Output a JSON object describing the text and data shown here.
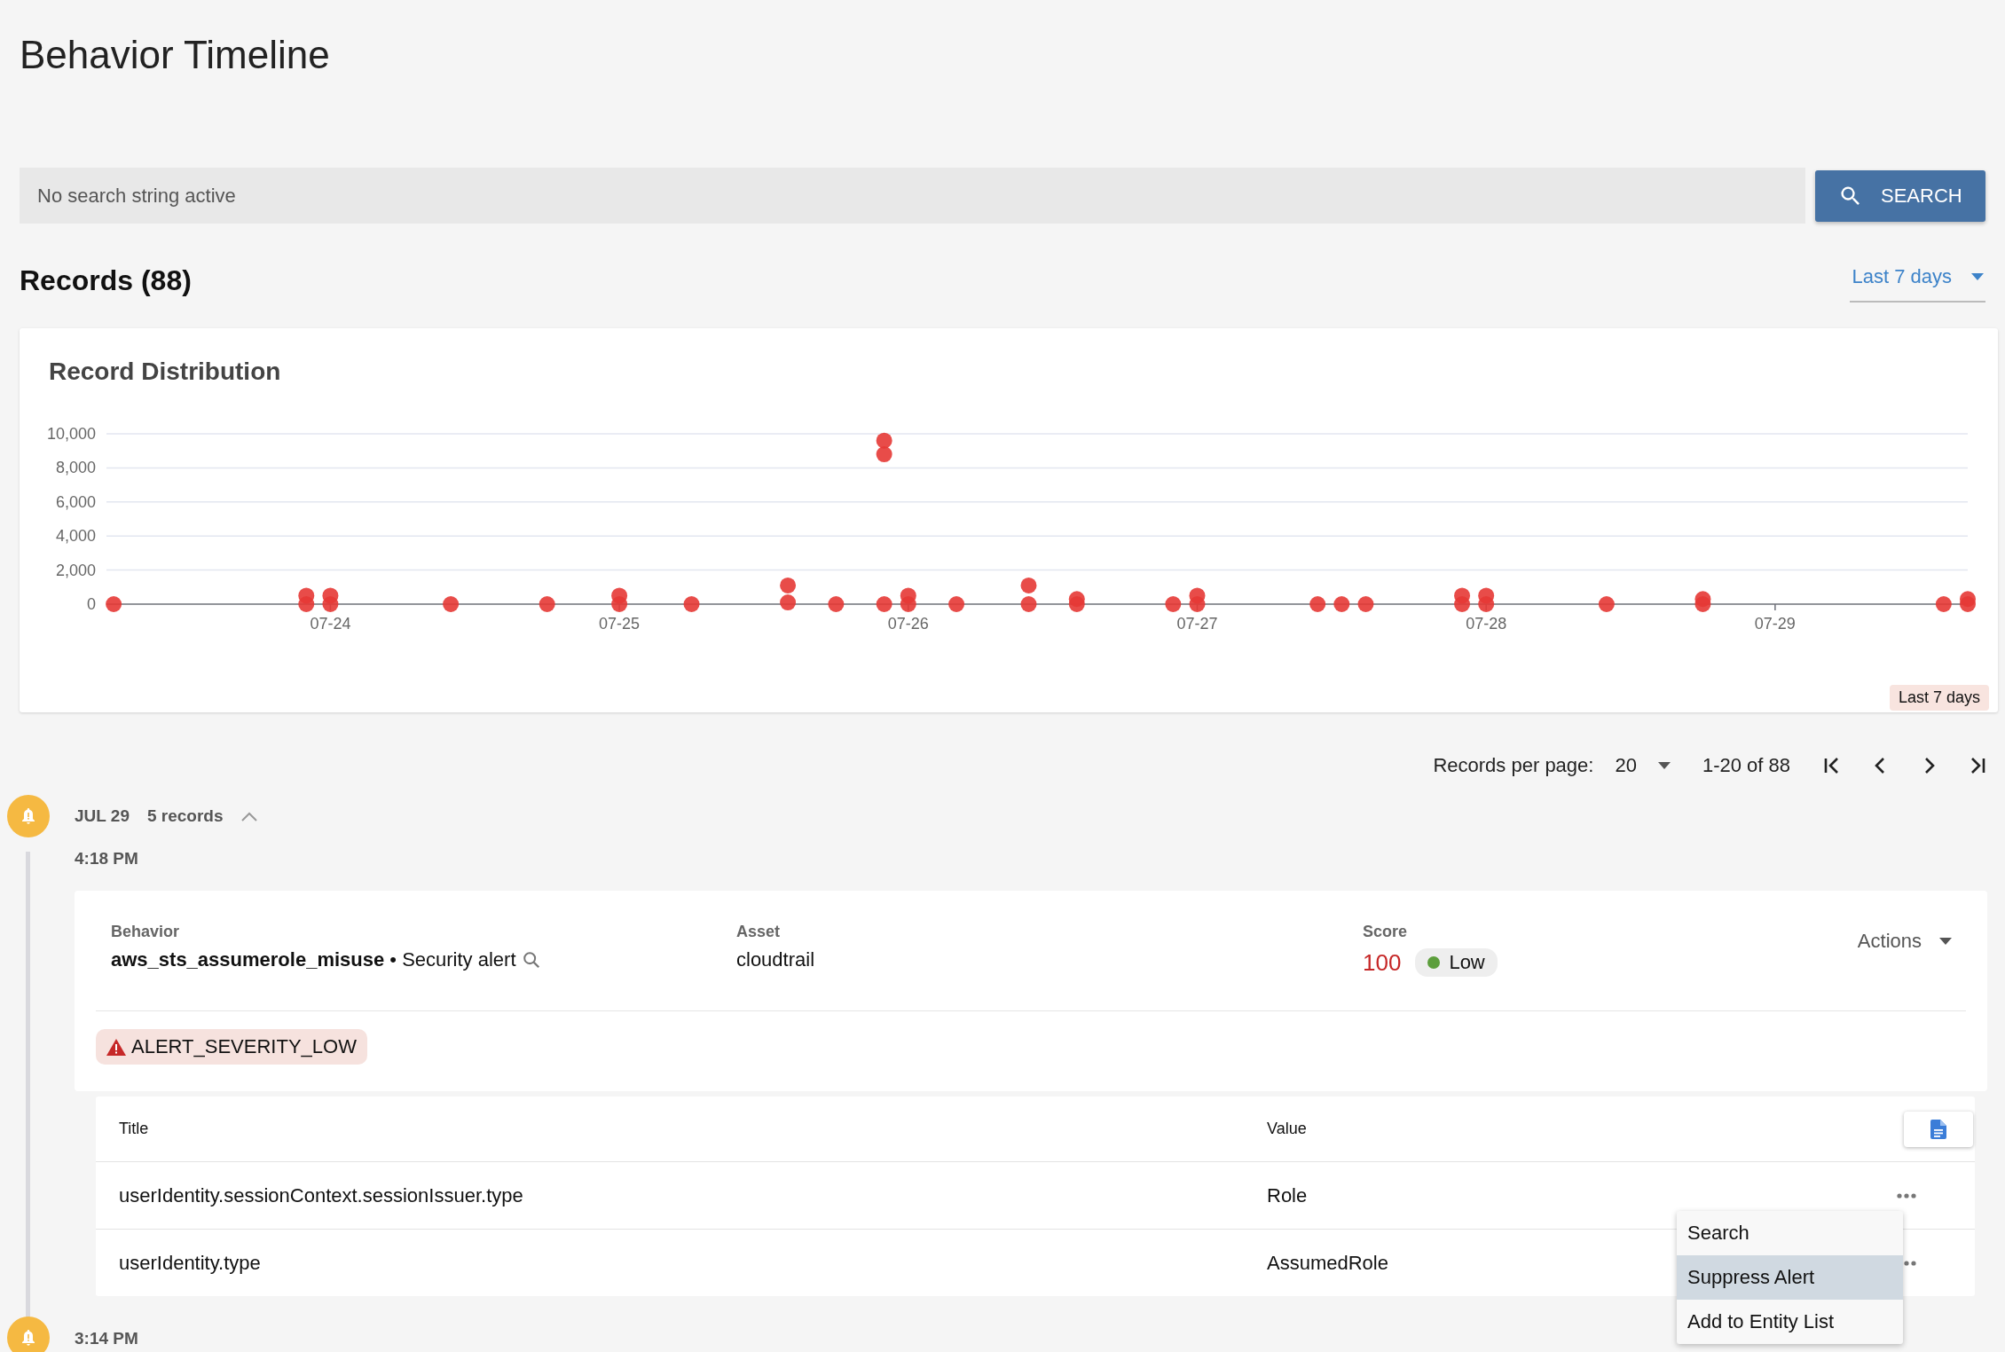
{
  "page_title": "Behavior Timeline",
  "search": {
    "placeholder": "No search string active",
    "button": "SEARCH"
  },
  "records_heading": "Records (88)",
  "range_dropdown": {
    "value": "Last 7 days"
  },
  "distribution": {
    "title": "Record Distribution",
    "range_badge": "Last 7 days",
    "chart_data": {
      "type": "scatter",
      "categories": [
        null,
        null,
        null,
        null,
        null,
        null,
        null,
        null,
        null,
        "07-24",
        null,
        null,
        null,
        null,
        null,
        null,
        null,
        null,
        null,
        null,
        null,
        "07-25",
        null,
        null,
        null,
        null,
        null,
        null,
        null,
        null,
        null,
        null,
        null,
        "07-26",
        null,
        null,
        null,
        null,
        null,
        null,
        null,
        null,
        null,
        null,
        null,
        "07-27",
        null,
        null,
        null,
        null,
        null,
        null,
        null,
        null,
        null,
        null,
        null,
        "07-28",
        null,
        null,
        null,
        null,
        null,
        null,
        null,
        null,
        null,
        null,
        null,
        "07-29",
        null,
        null,
        null,
        null,
        null,
        null,
        null,
        null
      ],
      "series": [
        {
          "color": "#e53935",
          "values": [
            0,
            null,
            null,
            null,
            null,
            null,
            null,
            null,
            0,
            0,
            null,
            null,
            null,
            null,
            0,
            null,
            null,
            null,
            0,
            null,
            null,
            0,
            null,
            null,
            0,
            null,
            null,
            null,
            100,
            null,
            0,
            null,
            0,
            0,
            null,
            0,
            null,
            null,
            0,
            null,
            0,
            null,
            null,
            null,
            0,
            0,
            null,
            null,
            null,
            null,
            0,
            0,
            0,
            null,
            null,
            null,
            0,
            0,
            null,
            null,
            null,
            null,
            0,
            null,
            null,
            null,
            0,
            null,
            null,
            null,
            null,
            null,
            null,
            null,
            null,
            null,
            0,
            0
          ]
        },
        {
          "color": "#e53935",
          "values": [
            null,
            null,
            null,
            null,
            null,
            null,
            null,
            null,
            500,
            500,
            null,
            null,
            null,
            null,
            null,
            null,
            null,
            null,
            null,
            null,
            null,
            500,
            null,
            null,
            null,
            null,
            null,
            null,
            1100,
            null,
            null,
            null,
            8800,
            500,
            null,
            null,
            null,
            null,
            1100,
            null,
            300,
            null,
            null,
            null,
            null,
            500,
            null,
            null,
            null,
            null,
            null,
            null,
            null,
            null,
            null,
            null,
            500,
            500,
            null,
            null,
            null,
            null,
            null,
            null,
            null,
            null,
            300,
            null,
            null,
            null,
            null,
            null,
            null,
            null,
            null,
            null,
            null,
            300
          ]
        },
        {
          "color": "#e53935",
          "values": [
            null,
            null,
            null,
            null,
            null,
            null,
            null,
            null,
            null,
            null,
            null,
            null,
            null,
            null,
            null,
            null,
            null,
            null,
            null,
            null,
            null,
            null,
            null,
            null,
            null,
            null,
            null,
            null,
            null,
            null,
            null,
            null,
            9600,
            null,
            null,
            null,
            null,
            null,
            null,
            null,
            null,
            null,
            null,
            null,
            null,
            null,
            null,
            null,
            null,
            null,
            null,
            null,
            null,
            null,
            null,
            null,
            null,
            null,
            null,
            null,
            null,
            null,
            null,
            null,
            null,
            null,
            null,
            null,
            null,
            null,
            null,
            null,
            null,
            null,
            null,
            null,
            null,
            null
          ]
        }
      ],
      "grid": true,
      "ylim": [
        0,
        10000
      ],
      "yticks": [
        {
          "value": 0,
          "label": "0"
        },
        {
          "value": 2000,
          "label": "2,000"
        },
        {
          "value": 4000,
          "label": "4,000"
        },
        {
          "value": 6000,
          "label": "6,000"
        },
        {
          "value": 8000,
          "label": "8,000"
        },
        {
          "value": 10000,
          "label": "10,000"
        }
      ]
    }
  },
  "pagination": {
    "label": "Records per page:",
    "per_page": "20",
    "range": "1-20 of 88"
  },
  "timeline": {
    "date": "JUL 29",
    "count": "5 records",
    "expanded": true,
    "entries": [
      {
        "time": "4:18 PM",
        "record": {
          "behavior_label": "Behavior",
          "behavior": "**aws_sts_assumerole_misuse** • Security alert",
          "asset_label": "Asset",
          "asset": "cloudtrail",
          "score_label": "Score",
          "score": "100",
          "severity": {
            "label": "Low",
            "color": "#5c9e3c"
          },
          "actions": "Actions",
          "alert_tag": "ALERT_SEVERITY_LOW",
          "table": {
            "columns": [
              "Title",
              "Value"
            ],
            "rows": [
              {
                "title": "userIdentity.sessionContext.sessionIssuer.type",
                "value": "Role",
                "menu": {
                  "items": [
                    {
                      "label": "Search",
                      "selected": false
                    },
                    {
                      "label": "Suppress Alert",
                      "selected": true
                    },
                    {
                      "label": "Add to Entity List",
                      "selected": false
                    }
                  ]
                }
              },
              {
                "title": "userIdentity.type",
                "value": "AssumedRole"
              }
            ]
          }
        }
      },
      {
        "time": "3:14 PM"
      }
    ]
  }
}
